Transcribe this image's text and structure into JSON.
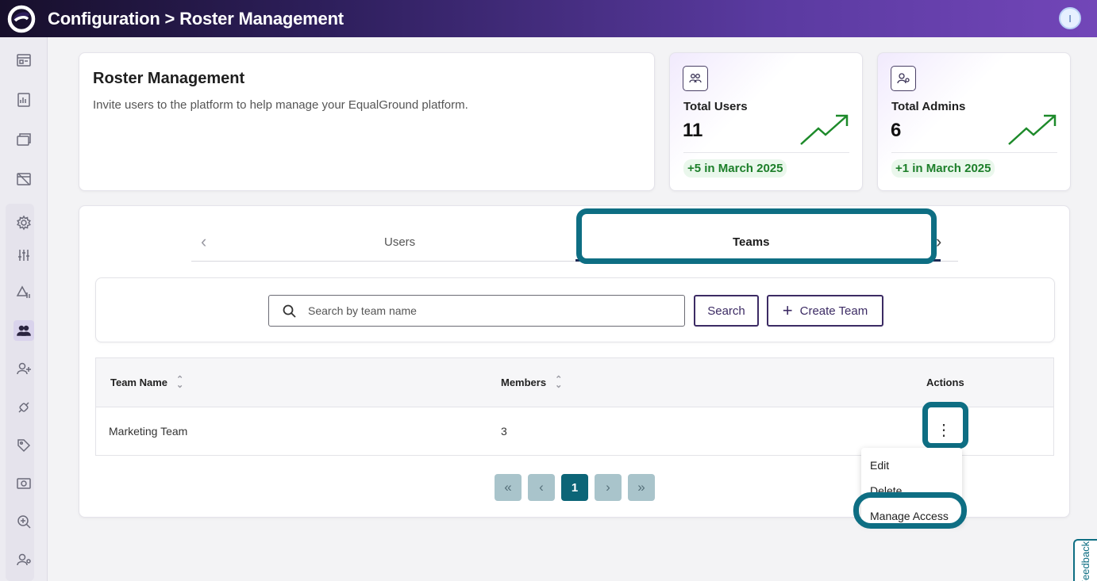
{
  "header": {
    "title": "Configuration > Roster Management",
    "avatar_initial": "I"
  },
  "sidebar": {
    "items": [
      {
        "icon": "dashboard-icon"
      },
      {
        "icon": "report-icon"
      },
      {
        "icon": "windows-icon"
      },
      {
        "icon": "calendar-off-icon"
      },
      {
        "icon": "gear-icon"
      },
      {
        "icon": "sliders-icon"
      },
      {
        "icon": "shapes-icon"
      },
      {
        "icon": "users-icon",
        "active": true
      },
      {
        "icon": "user-add-icon"
      },
      {
        "icon": "plug-icon"
      },
      {
        "icon": "tag-icon"
      },
      {
        "icon": "photo-icon"
      },
      {
        "icon": "zoom-icon"
      },
      {
        "icon": "user-settings-icon"
      }
    ]
  },
  "intro": {
    "title": "Roster Management",
    "description": "Invite users to the platform to help manage your EqualGround platform."
  },
  "stats": [
    {
      "label": "Total Users",
      "value": "11",
      "change": "+5 in March 2025",
      "icon": "users-icon"
    },
    {
      "label": "Total Admins",
      "value": "6",
      "change": "+1 in March 2025",
      "icon": "admin-icon"
    }
  ],
  "tabs": {
    "items": [
      "Users",
      "Teams"
    ],
    "active": "Teams"
  },
  "search": {
    "placeholder": "Search by team name",
    "value": "",
    "search_label": "Search",
    "create_label": "Create Team"
  },
  "table": {
    "headers": {
      "name": "Team Name",
      "members": "Members",
      "actions": "Actions"
    },
    "rows": [
      {
        "name": "Marketing Team",
        "members": "3"
      }
    ]
  },
  "actions_menu": {
    "items": [
      "Edit",
      "Delete",
      "Manage Access"
    ]
  },
  "pagination": {
    "first": "«",
    "prev": "‹",
    "current": "1",
    "next": "›",
    "last": "»"
  },
  "feedback": {
    "label": "Feedback"
  },
  "colors": {
    "accent": "#0e6e83",
    "brand_purple": "#5a3aa0",
    "positive": "#1d7f2a"
  }
}
